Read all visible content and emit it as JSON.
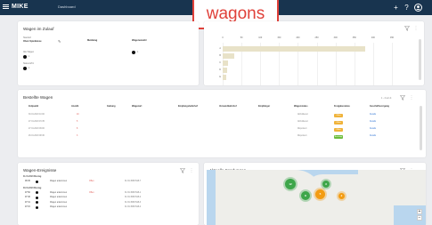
{
  "app": {
    "brand": "MIKE",
    "nav_tab": "Dashboard",
    "icons": [
      "plus-icon",
      "help-icon",
      "user-icon"
    ]
  },
  "banner": {
    "text": "wagons"
  },
  "panel_wagen": {
    "title": "Wagen im Zulauf",
    "meta": [
      {
        "label": "Standort",
        "value": "Oben Spielwiese"
      },
      {
        "label": "Alle Wagen",
        "value": "1"
      },
      {
        "label": "Status ETA",
        "value": "1"
      }
    ],
    "columns": [
      "Meldetag",
      "Wagenanzahl"
    ],
    "row_value": "1"
  },
  "panel_chart": {
    "chart_data": {
      "type": "bar",
      "orientation": "horizontal",
      "x_ticks": [
        "0",
        "50",
        "100",
        "150",
        "200",
        "250",
        "300",
        "350",
        "400",
        "450"
      ],
      "categories": [
        "A",
        "B",
        "C",
        "D",
        "E"
      ],
      "values": [
        380,
        30,
        15,
        12,
        10
      ],
      "xlim": [
        0,
        450
      ],
      "color": "#e8e2c8",
      "grid": true
    }
  },
  "panel_bestellt": {
    "title": "Bestellte Wagen",
    "pagination": "1 - 4 von 4",
    "columns": [
      "Zeitpunkt",
      "Anzahl",
      "Gattung",
      "Wagenart",
      "Empfangsbahnhof",
      "Versandbahnhof",
      "Empfänger",
      "Wagenstatus",
      "Freigabestatus",
      "Geschäftsvorgang"
    ],
    "rows": [
      {
        "time": "30.01.2023 10:00",
        "count": "10",
        "status": "Abholbereit",
        "pill": "Offen",
        "pill_color": "#f0b33a",
        "link": "Details"
      },
      {
        "time": "27.01.2023 15:35",
        "count": "5",
        "status": "Abholbereit",
        "pill": "Offen",
        "pill_color": "#f0b33a",
        "link": "Details"
      },
      {
        "time": "27.01.2023 09:00",
        "count": "8",
        "status": "Disponiert",
        "pill": "Offen",
        "pill_color": "#f0b33a",
        "link": "Details"
      },
      {
        "time": "26.01.2023 08:30",
        "count": "3",
        "status": "Disponiert",
        "pill": "Bestätigt",
        "pill_color": "#6bbd3a",
        "link": "Details"
      }
    ]
  },
  "panel_ereignisse": {
    "title": "Wagen-Ereignisse",
    "groups": [
      {
        "date": "31.01.2023 Montag",
        "rows": [
          {
            "time": "08:45",
            "event": "Wagen ankommen",
            "badge": "Offen",
            "wagon": "31 81 4596 548-7"
          }
        ]
      },
      {
        "date": "30.01.2023 Montag",
        "rows": [
          {
            "time": "07:50",
            "event": "Wagen ankommen",
            "badge": "Offen",
            "wagon": "31 81 4596 548-1"
          },
          {
            "time": "07:46",
            "event": "Wagen ankommen",
            "badge": "",
            "wagon": "31 81 4596 548-2"
          },
          {
            "time": "07:31",
            "event": "Wagen ankommen",
            "badge": "",
            "wagon": "31 81 4596 548-3"
          },
          {
            "time": "07:15",
            "event": "Wagen ankommen",
            "badge": "",
            "wagon": "31 81 4596 548-4"
          }
        ]
      }
    ]
  },
  "panel_sendungen": {
    "title": "Aktuelle Sendungen",
    "pagination": "1 - 5 von 5",
    "clusters": [
      {
        "label": "12",
        "color": "#3da64a"
      },
      {
        "label": "8",
        "color": "#3da64a"
      },
      {
        "label": "5",
        "color": "#f39c12"
      },
      {
        "label": "3",
        "color": "#3da64a"
      },
      {
        "label": "2",
        "color": "#f39c12"
      }
    ],
    "zoom_in": "+",
    "zoom_out": "−"
  }
}
